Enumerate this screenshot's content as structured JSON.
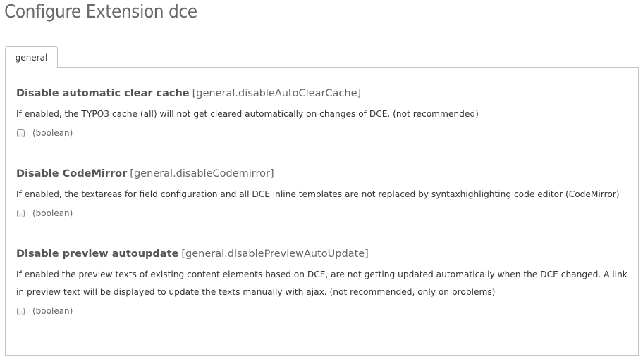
{
  "page": {
    "title": "Configure Extension dce"
  },
  "tabs": [
    {
      "label": "general"
    }
  ],
  "settings": [
    {
      "label": "Disable automatic clear cache",
      "key": "[general.disableAutoClearCache]",
      "description": "If enabled, the TYPO3 cache (all) will not get cleared automatically on changes of DCE. (not recommended)",
      "type": "(boolean)",
      "checked": false
    },
    {
      "label": "Disable CodeMirror",
      "key": "[general.disableCodemirror]",
      "description": "If enabled, the textareas for field configuration and all DCE inline templates are not replaced by syntaxhighlighting code editor (CodeMirror)",
      "type": "(boolean)",
      "checked": false
    },
    {
      "label": "Disable preview autoupdate",
      "key": "[general.disablePreviewAutoUpdate]",
      "description": "If enabled the preview texts of existing content elements based on DCE, are not getting updated automatically when the DCE changed. A link in preview text will be displayed to update the texts manually with ajax. (not recommended, only on problems)",
      "type": "(boolean)",
      "checked": false
    }
  ]
}
